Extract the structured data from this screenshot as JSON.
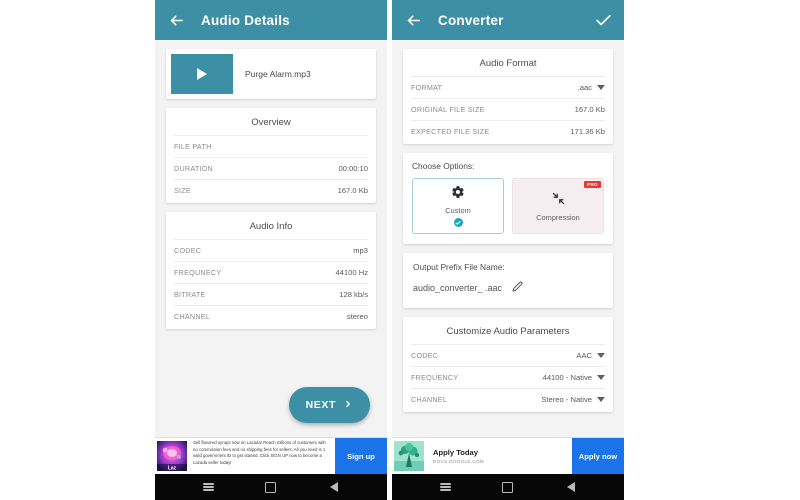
{
  "left_screen": {
    "appbar": {
      "title": "Audio Details",
      "back_icon": "arrow-left-icon"
    },
    "file": {
      "name": "Purge Alarm.mp3",
      "play_icon": "play-icon"
    },
    "overview": {
      "title": "Overview",
      "rows": [
        {
          "label": "FILE PATH",
          "value": ""
        },
        {
          "label": "DURATION",
          "value": "00:00:10"
        },
        {
          "label": "SIZE",
          "value": "167.0 Kb"
        }
      ]
    },
    "audio_info": {
      "title": "Audio Info",
      "rows": [
        {
          "label": "CODEC",
          "value": "mp3"
        },
        {
          "label": "FREQUNECY",
          "value": "44100 Hz"
        },
        {
          "label": "BITRATE",
          "value": "128 kb/s"
        },
        {
          "label": "CHANNEL",
          "value": "stereo"
        }
      ]
    },
    "next_button": {
      "label": "NEXT",
      "icon": "chevron-right-icon"
    }
  },
  "right_screen": {
    "appbar": {
      "title": "Converter",
      "back_icon": "arrow-left-icon",
      "confirm_icon": "check-icon"
    },
    "audio_format": {
      "title": "Audio Format",
      "rows": [
        {
          "label": "FORMAT",
          "value": ".aac",
          "has_caret": true
        },
        {
          "label": "ORIGINAL FILE SIZE",
          "value": "167.0 Kb",
          "has_caret": false
        },
        {
          "label": "EXPECTED FILE SIZE",
          "value": "171.36 Kb",
          "has_caret": false
        }
      ]
    },
    "choose_options": {
      "heading": "Choose Options:",
      "options": [
        {
          "label": "Custom",
          "icon": "gear-icon",
          "selected": true,
          "pro": false
        },
        {
          "label": "Compression",
          "icon": "compress-arrows-icon",
          "selected": false,
          "pro": true,
          "pro_label": "PRO"
        }
      ]
    },
    "output_prefix": {
      "heading": "Output Prefix File Name:",
      "value": "audio_converter_ .aac",
      "edit_icon": "pencil-icon"
    },
    "customize_params": {
      "title": "Customize Audio Parameters",
      "rows": [
        {
          "label": "CODEC",
          "value": "AAC"
        },
        {
          "label": "FREQUENCY",
          "value": "44100 - Native"
        },
        {
          "label": "CHANNEL",
          "value": "Stereo - Native"
        }
      ]
    }
  },
  "ads": {
    "left": {
      "copy": "Sell flavored syrups now on Lazada! Reach millions of customers with no commission fees and no shipping fees for sellers. All you need is 1 valid government ID to get started. Click SIGN UP now to become a Lazada seller today!",
      "cta": "Sign up",
      "logo_icon": "lazada-logo-icon"
    },
    "right": {
      "title": "Apply Today",
      "url": "DOCS.GOOGLE.COM",
      "cta": "Apply now",
      "logo_icon": "ad-thumbnail-icon"
    }
  },
  "navbar": {
    "recents_icon": "recents-icon",
    "home_icon": "home-square-icon",
    "back_icon": "back-triangle-icon"
  },
  "colors": {
    "teal": "#3d8fa5",
    "accent_check": "#1aa7b8",
    "pro_red": "#e53935",
    "ad_blue": "#1a73e8"
  }
}
